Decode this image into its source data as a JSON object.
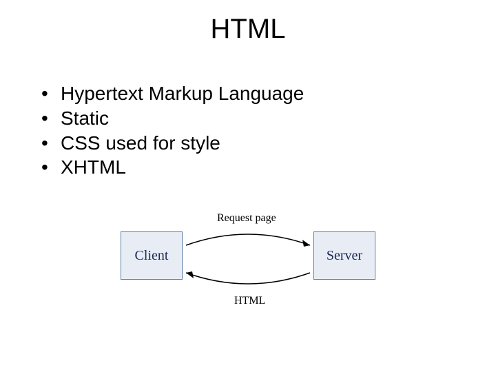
{
  "title": "HTML",
  "bullets": [
    "Hypertext Markup Language",
    "Static",
    "CSS used for style",
    "XHTML"
  ],
  "diagram": {
    "client_label": "Client",
    "server_label": "Server",
    "request_label": "Request page",
    "response_label": "HTML"
  }
}
